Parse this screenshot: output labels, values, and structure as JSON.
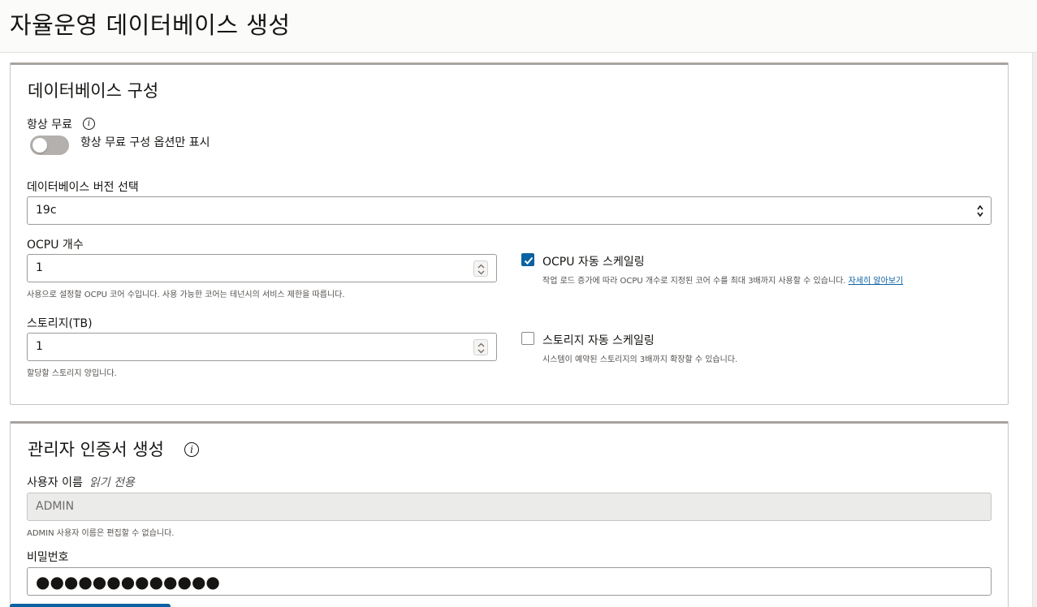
{
  "page": {
    "title": "자율운영 데이터베이스 생성"
  },
  "db_config": {
    "title": "데이터베이스 구성",
    "always_free": {
      "label": "항상 무료",
      "toggle_label": "항상 무료 구성 옵션만 표시",
      "enabled": false
    },
    "version": {
      "label": "데이터베이스 버전 선택",
      "value": "19c"
    },
    "ocpu": {
      "label": "OCPU 개수",
      "value": "1",
      "help": "사용으로 설정할 OCPU 코어 수입니다. 사용 가능한 코어는 테넌시의 서비스 제한을 따릅니다."
    },
    "ocpu_autoscaling": {
      "label": "OCPU 자동 스케일링",
      "checked": true,
      "help": "작업 로드 증가에 따라 OCPU 개수로 지정된 코어 수를 최대 3배까지 사용할 수 있습니다.",
      "link": "자세히 알아보기"
    },
    "storage": {
      "label": "스토리지(TB)",
      "value": "1",
      "help": "할당할 스토리지 양입니다."
    },
    "storage_autoscaling": {
      "label": "스토리지 자동 스케일링",
      "checked": false,
      "help": "시스템이 예약된 스토리지의 3배까지 확장할 수 있습니다."
    }
  },
  "admin_creds": {
    "title": "관리자 인증서 생성",
    "username": {
      "label": "사용자 이름",
      "readonly_note": "읽기 전용",
      "value": "ADMIN",
      "help": "ADMIN 사용자 이름은 편집할 수 없습니다."
    },
    "password": {
      "label": "비밀번호",
      "value": "●●●●●●●●●●●●●"
    }
  },
  "colors": {
    "accent": "#0b62a3",
    "toggle_off": "#b3b0ad",
    "border": "#9e9a96",
    "readonly_bg": "#ebebea"
  },
  "icons": [
    "info-icon",
    "select-arrows-icon",
    "spinner-icon",
    "check-icon"
  ]
}
